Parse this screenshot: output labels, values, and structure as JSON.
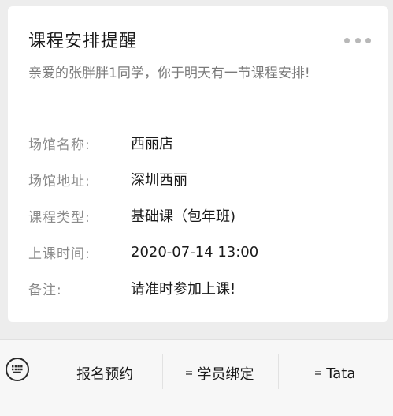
{
  "card": {
    "title": "课程安排提醒",
    "description": "亲爱的张胖胖1同学，你于明天有一节课程安排!",
    "more_icon": "more-dots-icon",
    "fields": [
      {
        "label": "场馆名称:",
        "value": "西丽店"
      },
      {
        "label": "场馆地址:",
        "value": "深圳西丽"
      },
      {
        "label": "课程类型:",
        "value": "基础课（包年班)"
      },
      {
        "label": "上课时间:",
        "value": "2020-07-14 13:00"
      },
      {
        "label": "备注:",
        "value": "请准时参加上课!"
      }
    ]
  },
  "bottom_menu": {
    "keyboard_icon": "keyboard-icon",
    "items": [
      {
        "label": "报名预约",
        "has_submenu": false
      },
      {
        "label": "学员绑定",
        "has_submenu": true
      },
      {
        "label": "Tata",
        "has_submenu": true
      }
    ]
  }
}
